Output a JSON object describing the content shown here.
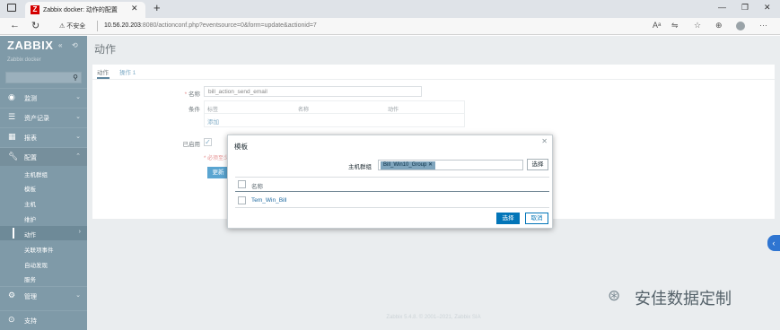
{
  "browser": {
    "tab_title": "Zabbix docker: 动作的配置",
    "tab_favicon": "Z",
    "url_warning": "不安全",
    "url_host": "10.56.20.203",
    "url_rest": ":8080/actionconf.php?eventsource=0&form=update&actionid=7",
    "icons": [
      "back-icon",
      "refresh-icon",
      "read-aloud-icon",
      "translate-icon",
      "favorites-icon",
      "collections-icon",
      "profile-icon",
      "more-icon"
    ]
  },
  "sidebar": {
    "logo": "ZABBIX",
    "server_name": "Zabbix docker",
    "menu": [
      {
        "label": "监测",
        "icon": "eye-icon"
      },
      {
        "label": "资产记录",
        "icon": "list-icon"
      },
      {
        "label": "报表",
        "icon": "chart-icon"
      },
      {
        "label": "配置",
        "icon": "wrench-icon"
      }
    ],
    "submenu": [
      "主机群组",
      "模板",
      "主机",
      "维护",
      "动作",
      "关联项事件",
      "自动发现",
      "服务"
    ],
    "bottom": [
      {
        "label": "管理",
        "icon": "gear-icon"
      },
      {
        "label": "支持",
        "icon": "support-icon"
      }
    ]
  },
  "page": {
    "title": "动作",
    "tabs": [
      "动作",
      "操作 1"
    ],
    "form": {
      "name_label": "名称",
      "name_value": "bill_action_send_email",
      "conditions_label": "条件",
      "cond_headers": [
        "标签",
        "名称",
        "动作"
      ],
      "add_link": "添加",
      "enabled_label": "已启用",
      "required_note": "* 必须至少设置一个执行内容。",
      "update_button": "更新"
    },
    "footer": "Zabbix 5.4.8. © 2001–2021, Zabbix SIA"
  },
  "modal": {
    "title": "模板",
    "group_label": "主机群组",
    "group_chip": "Bill_Win10_Group",
    "select_button": "选择",
    "column_header": "名称",
    "rows": [
      "Tem_Win_Bill"
    ],
    "confirm_button": "选择",
    "cancel_button": "取消"
  },
  "watermark": "安佳数据定制",
  "colors": {
    "sidebar_bg": "#7f9aa8",
    "primary": "#0275b8",
    "link": "#3b7fa8",
    "page_bg": "#dfe4e7"
  }
}
